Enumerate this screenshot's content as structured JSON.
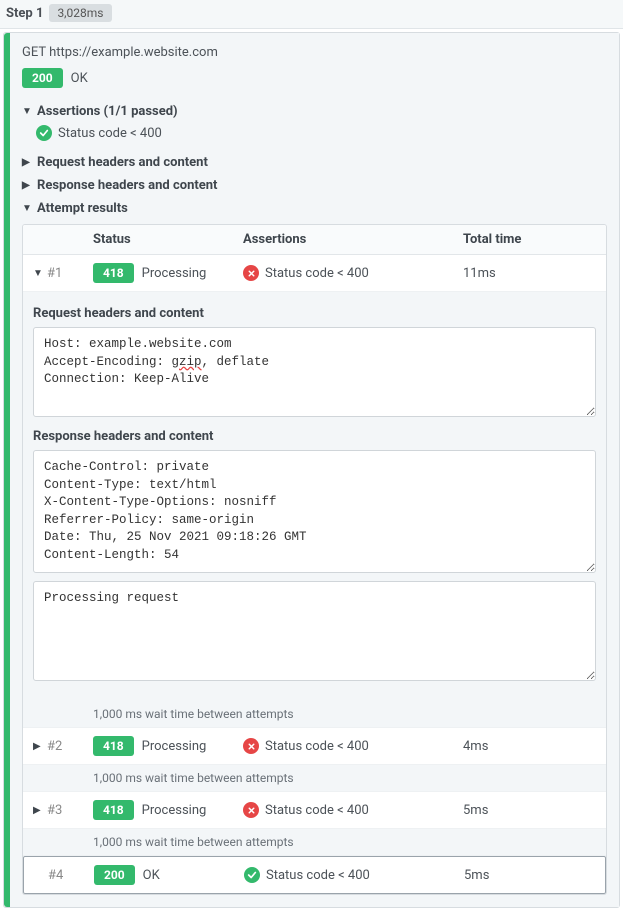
{
  "step": {
    "label": "Step 1",
    "duration": "3,028ms"
  },
  "request": {
    "method_url": "GET https://example.website.com",
    "status_code": "200",
    "status_text": "OK"
  },
  "assertions": {
    "header": "Assertions (1/1 passed)",
    "item": "Status code < 400"
  },
  "sections": {
    "req": "Request headers and content",
    "res": "Response headers and content",
    "attempts": "Attempt results"
  },
  "table": {
    "col_status": "Status",
    "col_assert": "Assertions",
    "col_time": "Total time"
  },
  "attempts": {
    "a1": {
      "num": "#1",
      "code": "418",
      "status": "Processing",
      "assert": "Status code < 400",
      "time": "11ms"
    },
    "a2": {
      "num": "#2",
      "code": "418",
      "status": "Processing",
      "assert": "Status code < 400",
      "time": "4ms"
    },
    "a3": {
      "num": "#3",
      "code": "418",
      "status": "Processing",
      "assert": "Status code < 400",
      "time": "5ms"
    },
    "a4": {
      "num": "#4",
      "code": "200",
      "status": "OK",
      "assert": "Status code < 400",
      "time": "5ms"
    }
  },
  "wait_text": "1,000 ms wait time between attempts",
  "detail": {
    "req_label": "Request headers and content",
    "req_text_pre": "Host: example.website.com\nAccept-Encoding: ",
    "req_gzip": "gzip",
    "req_text_post": ", deflate\nConnection: Keep-Alive",
    "res_label": "Response headers and content",
    "res_headers": "Cache-Control: private\nContent-Type: text/html\nX-Content-Type-Options: nosniff\nReferrer-Policy: same-origin\nDate: Thu, 25 Nov 2021 09:18:26 GMT\nContent-Length: 54",
    "res_body": "Processing request"
  }
}
